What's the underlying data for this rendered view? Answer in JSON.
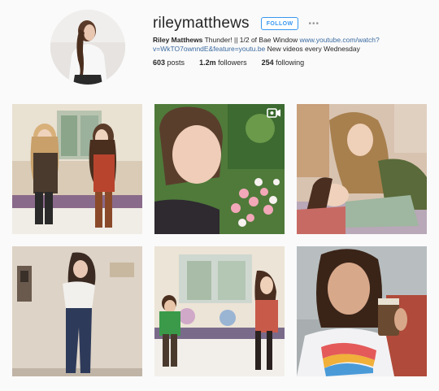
{
  "profile": {
    "username": "rileymatthews",
    "follow_label": "FOLLOW",
    "more_label": "•••",
    "full_name": "Riley Matthews",
    "bio_text": " Thunder! || 1/2 of Bae Window ",
    "bio_link": "www.youtube.com/watch?v=WkTO7ownndE&feature=youtu.be",
    "bio_tail": " New videos every Wednesday"
  },
  "stats": {
    "posts_count": "603",
    "posts_label": "posts",
    "followers_count": "1.2m",
    "followers_label": "followers",
    "following_count": "254",
    "following_label": "following"
  },
  "posts": [
    {
      "id": "post-1",
      "type": "photo",
      "icon": "none"
    },
    {
      "id": "post-2",
      "type": "video",
      "icon": "video-camera-icon"
    },
    {
      "id": "post-3",
      "type": "photo",
      "icon": "none"
    },
    {
      "id": "post-4",
      "type": "photo",
      "icon": "none"
    },
    {
      "id": "post-5",
      "type": "photo",
      "icon": "none"
    },
    {
      "id": "post-6",
      "type": "photo",
      "icon": "none"
    }
  ],
  "colors": {
    "accent": "#3897f0",
    "link": "#3a6aa0",
    "background": "#fafafa"
  }
}
